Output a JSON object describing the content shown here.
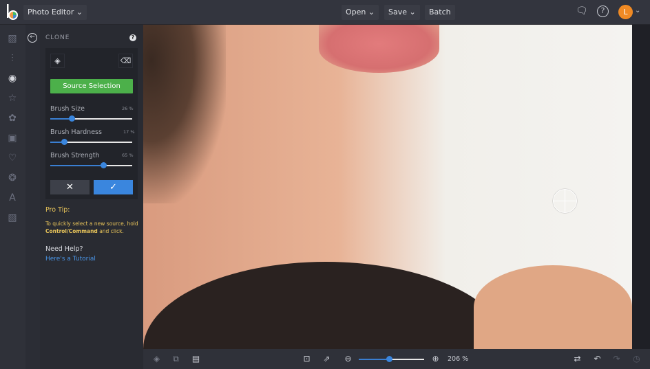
{
  "header": {
    "app_title": "Photo Editor",
    "menu": [
      "Open",
      "Save",
      "Batch"
    ],
    "avatar_letter": "L"
  },
  "panel": {
    "title": "CLONE",
    "source_selection": "Source Selection",
    "sliders": [
      {
        "label": "Brush Size",
        "value": 26,
        "display": "26 %"
      },
      {
        "label": "Brush Hardness",
        "value": 17,
        "display": "17 %"
      },
      {
        "label": "Brush Strength",
        "value": 65,
        "display": "65 %"
      }
    ],
    "pro_tip_title": "Pro Tip:",
    "pro_tip_text": "To quickly select a new source, hold",
    "pro_tip_bold": "Control/Command",
    "pro_tip_end": "and click.",
    "help_title": "Need Help?",
    "help_link": "Here's a Tutorial"
  },
  "zoom": {
    "value": 206,
    "display": "206 %"
  },
  "colors": {
    "accent": "#3a86de",
    "green": "#4cb04a",
    "tip": "#e8c45a",
    "avatar": "#f08a24"
  }
}
